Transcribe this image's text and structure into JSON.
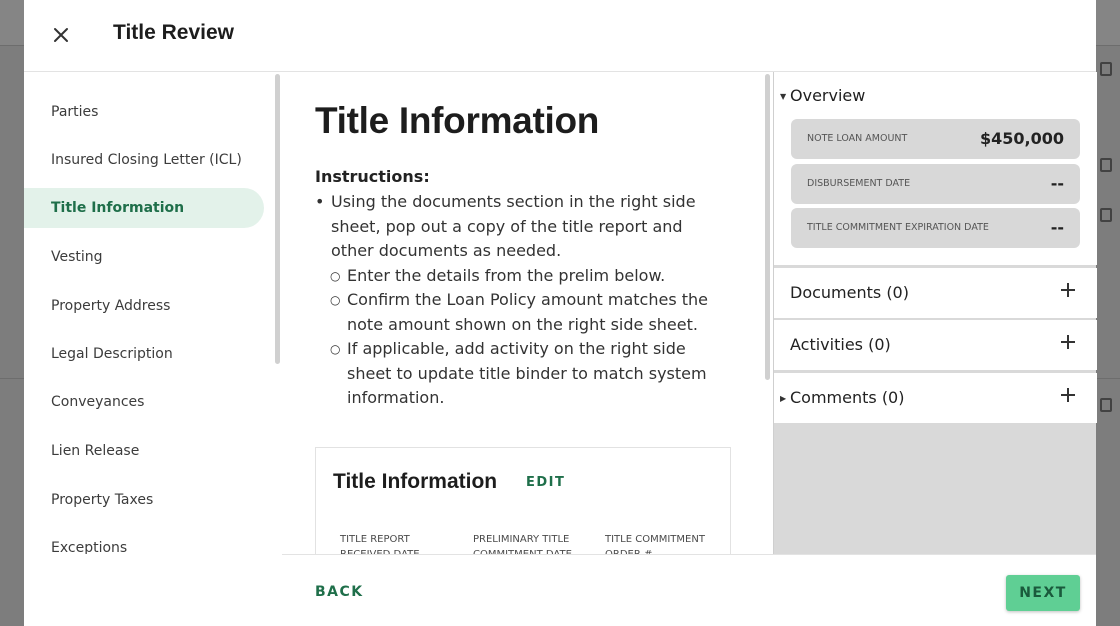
{
  "modal": {
    "title": "Title Review"
  },
  "nav": {
    "items": [
      {
        "label": "Parties",
        "active": false
      },
      {
        "label": "Insured Closing Letter (ICL)",
        "active": false
      },
      {
        "label": "Title Information",
        "active": true
      },
      {
        "label": "Vesting",
        "active": false
      },
      {
        "label": "Property Address",
        "active": false
      },
      {
        "label": "Legal Description",
        "active": false
      },
      {
        "label": "Conveyances",
        "active": false
      },
      {
        "label": "Lien Release",
        "active": false
      },
      {
        "label": "Property Taxes",
        "active": false
      },
      {
        "label": "Exceptions",
        "active": false
      }
    ]
  },
  "main": {
    "page_title": "Title Information",
    "instructions_heading": "Instructions:",
    "instructions": {
      "main": "Using the documents section in the right side sheet, pop out a copy of the title report and other documents as needed.",
      "sub": [
        "Enter the details from the prelim below.",
        "Confirm the Loan Policy amount matches the note amount shown on the right side sheet.",
        "If applicable, add activity on the right side sheet to update title binder to match system information."
      ]
    },
    "card": {
      "title": "Title Information",
      "edit_label": "EDIT",
      "columns": [
        "TITLE REPORT RECEIVED DATE",
        "PRELIMINARY TITLE COMMITMENT DATE",
        "TITLE COMMITMENT ORDER #"
      ]
    }
  },
  "footer": {
    "back_label": "BACK",
    "next_label": "NEXT"
  },
  "right_panel": {
    "overview_label": "Overview",
    "rows": [
      {
        "label": "NOTE LOAN AMOUNT",
        "value": "$450,000"
      },
      {
        "label": "DISBURSEMENT DATE",
        "value": "--"
      },
      {
        "label": "TITLE COMMITMENT EXPIRATION DATE",
        "value": "--"
      }
    ],
    "sections": [
      {
        "label": "Documents (0)"
      },
      {
        "label": "Activities (0)"
      },
      {
        "label": "Comments (0)"
      }
    ]
  },
  "colors": {
    "accent": "#1f6f4a",
    "active_bg": "#e3f2ea",
    "next_bg": "#5fcf94"
  }
}
